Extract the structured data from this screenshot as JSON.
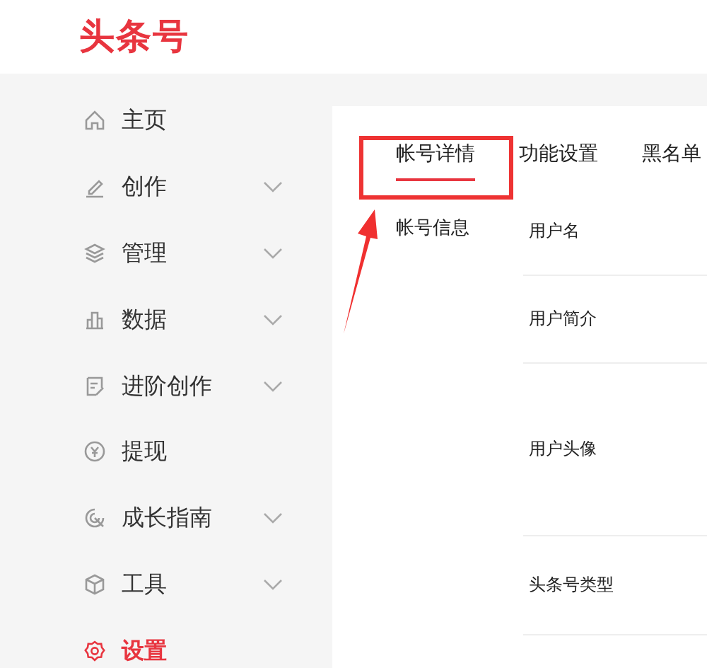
{
  "logo": "头条号",
  "sidebar": {
    "items": [
      {
        "label": "主页",
        "expandable": false,
        "selected": false
      },
      {
        "label": "创作",
        "expandable": true,
        "selected": false
      },
      {
        "label": "管理",
        "expandable": true,
        "selected": false
      },
      {
        "label": "数据",
        "expandable": true,
        "selected": false
      },
      {
        "label": "进阶创作",
        "expandable": true,
        "selected": false
      },
      {
        "label": "提现",
        "expandable": false,
        "selected": false
      },
      {
        "label": "成长指南",
        "expandable": true,
        "selected": false
      },
      {
        "label": "工具",
        "expandable": true,
        "selected": false
      },
      {
        "label": "设置",
        "expandable": false,
        "selected": true
      }
    ]
  },
  "tabs": [
    {
      "label": "帐号详情",
      "selected": true
    },
    {
      "label": "功能设置",
      "selected": false
    },
    {
      "label": "黑名单",
      "selected": false
    }
  ],
  "section": "帐号信息",
  "rows": [
    {
      "label": "用户名"
    },
    {
      "label": "用户简介"
    },
    {
      "label": "用户头像"
    },
    {
      "label": "头条号类型"
    }
  ]
}
